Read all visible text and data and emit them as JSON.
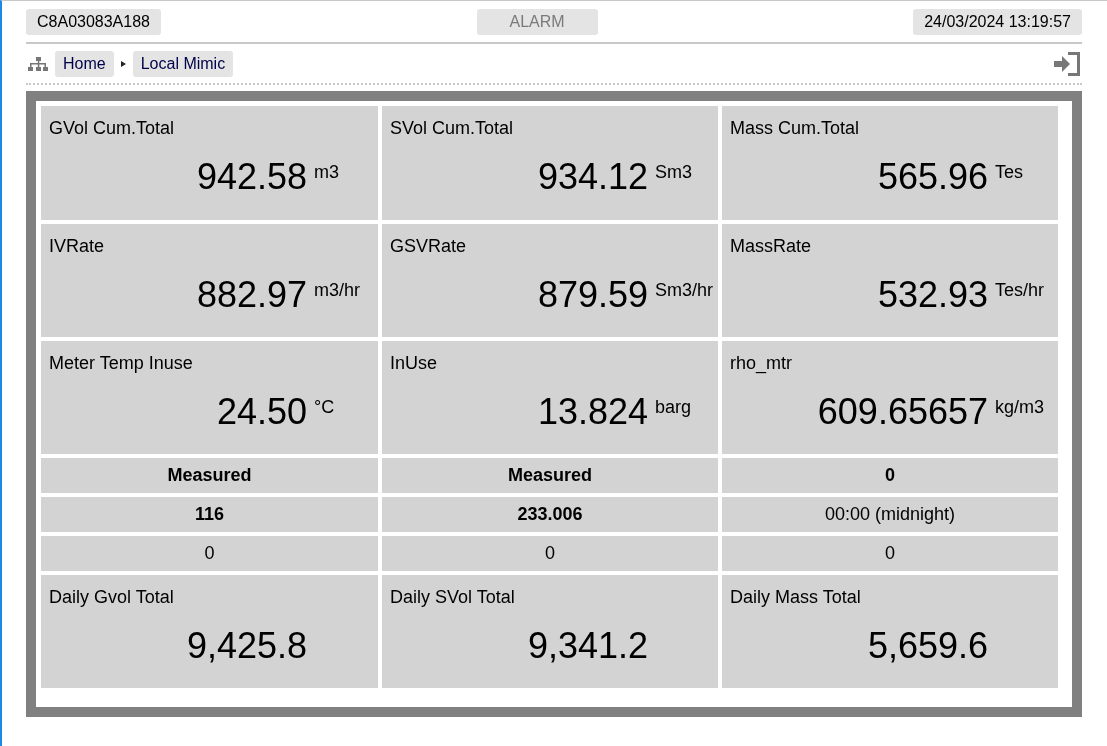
{
  "header": {
    "device_id": "C8A03083A188",
    "alarm": {
      "label": "ALARM",
      "active": false
    },
    "datetime": "24/03/2024 13:19:57"
  },
  "breadcrumb": [
    {
      "label": "Home"
    },
    {
      "label": "Local Mimic"
    }
  ],
  "rows": [
    {
      "kind": "tile",
      "cells": [
        {
          "label": "GVol Cum.Total",
          "value": "942.58",
          "unit": "m3"
        },
        {
          "label": "SVol Cum.Total",
          "value": "934.12",
          "unit": "Sm3"
        },
        {
          "label": "Mass Cum.Total",
          "value": "565.96",
          "unit": "Tes"
        }
      ]
    },
    {
      "kind": "tile",
      "cells": [
        {
          "label": "IVRate",
          "value": "882.97",
          "unit": "m3/hr"
        },
        {
          "label": "GSVRate",
          "value": "879.59",
          "unit": "Sm3/hr"
        },
        {
          "label": "MassRate",
          "value": "532.93",
          "unit": "Tes/hr"
        }
      ]
    },
    {
      "kind": "tile",
      "cells": [
        {
          "label": "Meter Temp Inuse",
          "value": "24.50",
          "unit": "°C"
        },
        {
          "label": "InUse",
          "value": "13.824",
          "unit": "barg"
        },
        {
          "label": "rho_mtr",
          "value": "609.65657",
          "unit": "kg/m3"
        }
      ]
    },
    {
      "kind": "text",
      "cells": [
        {
          "text": "Measured",
          "bold": true
        },
        {
          "text": "Measured",
          "bold": true
        },
        {
          "text": "0",
          "bold": true
        }
      ]
    },
    {
      "kind": "text",
      "cells": [
        {
          "text": "116",
          "bold": true
        },
        {
          "text": "233.006",
          "bold": true
        },
        {
          "text": "00:00 (midnight)",
          "bold": false
        }
      ]
    },
    {
      "kind": "text",
      "cells": [
        {
          "text": "0",
          "bold": false
        },
        {
          "text": "0",
          "bold": false
        },
        {
          "text": "0",
          "bold": false
        }
      ]
    },
    {
      "kind": "tile",
      "cells": [
        {
          "label": "Daily Gvol Total",
          "value": "9,425.8"
        },
        {
          "label": "Daily SVol Total",
          "value": "9,341.2"
        },
        {
          "label": "Daily Mass Total",
          "value": "5,659.6"
        }
      ]
    }
  ]
}
